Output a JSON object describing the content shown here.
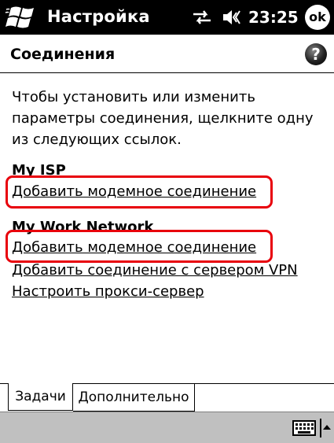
{
  "titlebar": {
    "title": "Настройка",
    "clock": "23:25",
    "ok_label": "ok"
  },
  "header": {
    "title": "Соединения",
    "help_glyph": "?"
  },
  "instructions": "Чтобы установить или изменить параметры соединения, щелкните одну из следующих ссылок.",
  "groups": [
    {
      "title": "My ISP",
      "links": [
        {
          "label": "Добавить модемное соединение",
          "highlighted": true
        }
      ]
    },
    {
      "title": "My Work Network",
      "links": [
        {
          "label": "Добавить модемное соединение",
          "highlighted": true
        },
        {
          "label": "Добавить соединение с сервером VPN",
          "highlighted": false
        },
        {
          "label": "Настроить прокси-сервер",
          "highlighted": false
        }
      ]
    }
  ],
  "tabs": [
    {
      "label": "Задачи",
      "active": true
    },
    {
      "label": "Дополнительно",
      "active": false
    }
  ],
  "icons": {
    "start": "windows-flag-icon",
    "connectivity": "connectivity-arrows-icon",
    "volume": "speaker-icon",
    "help": "help-icon",
    "keyboard": "keyboard-icon",
    "sip_toggle": "arrow-up-icon"
  },
  "colors": {
    "titlebar_bg": "#000000",
    "highlight": "#e8000b",
    "menubar_bg": "#c0c0c0"
  }
}
